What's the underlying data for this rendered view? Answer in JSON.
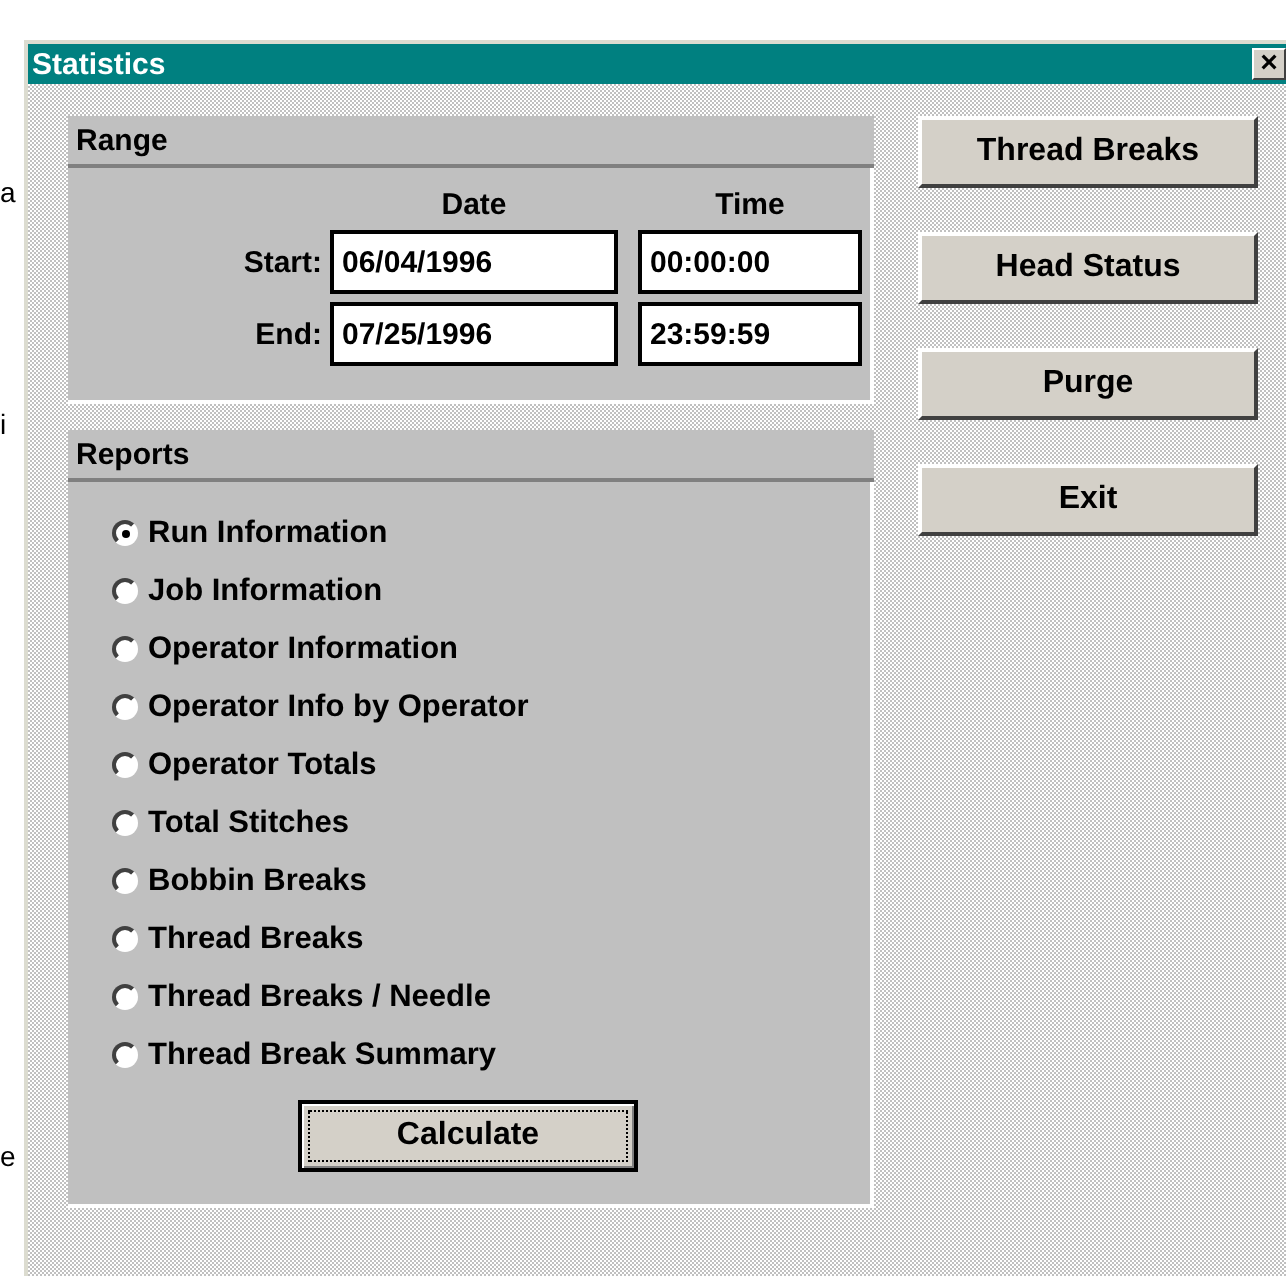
{
  "background_fragments": [
    "a",
    "i",
    "e"
  ],
  "window": {
    "title": "Statistics",
    "close": "×"
  },
  "range": {
    "title": "Range",
    "columns": [
      "Date",
      "Time"
    ],
    "rows": [
      {
        "label": "Start:",
        "date": "06/04/1996",
        "time": "00:00:00"
      },
      {
        "label": "End:",
        "date": "07/25/1996",
        "time": "23:59:59"
      }
    ]
  },
  "reports": {
    "title": "Reports",
    "options": [
      {
        "label": "Run Information",
        "selected": true
      },
      {
        "label": "Job Information",
        "selected": false
      },
      {
        "label": "Operator Information",
        "selected": false
      },
      {
        "label": "Operator Info by Operator",
        "selected": false
      },
      {
        "label": "Operator Totals",
        "selected": false
      },
      {
        "label": "Total Stitches",
        "selected": false
      },
      {
        "label": "Bobbin Breaks",
        "selected": false
      },
      {
        "label": "Thread Breaks",
        "selected": false
      },
      {
        "label": "Thread Breaks / Needle",
        "selected": false
      },
      {
        "label": "Thread Break Summary",
        "selected": false
      }
    ],
    "button": "Calculate"
  },
  "buttons": [
    "Thread Breaks",
    "Head Status",
    "Purge",
    "Exit"
  ]
}
